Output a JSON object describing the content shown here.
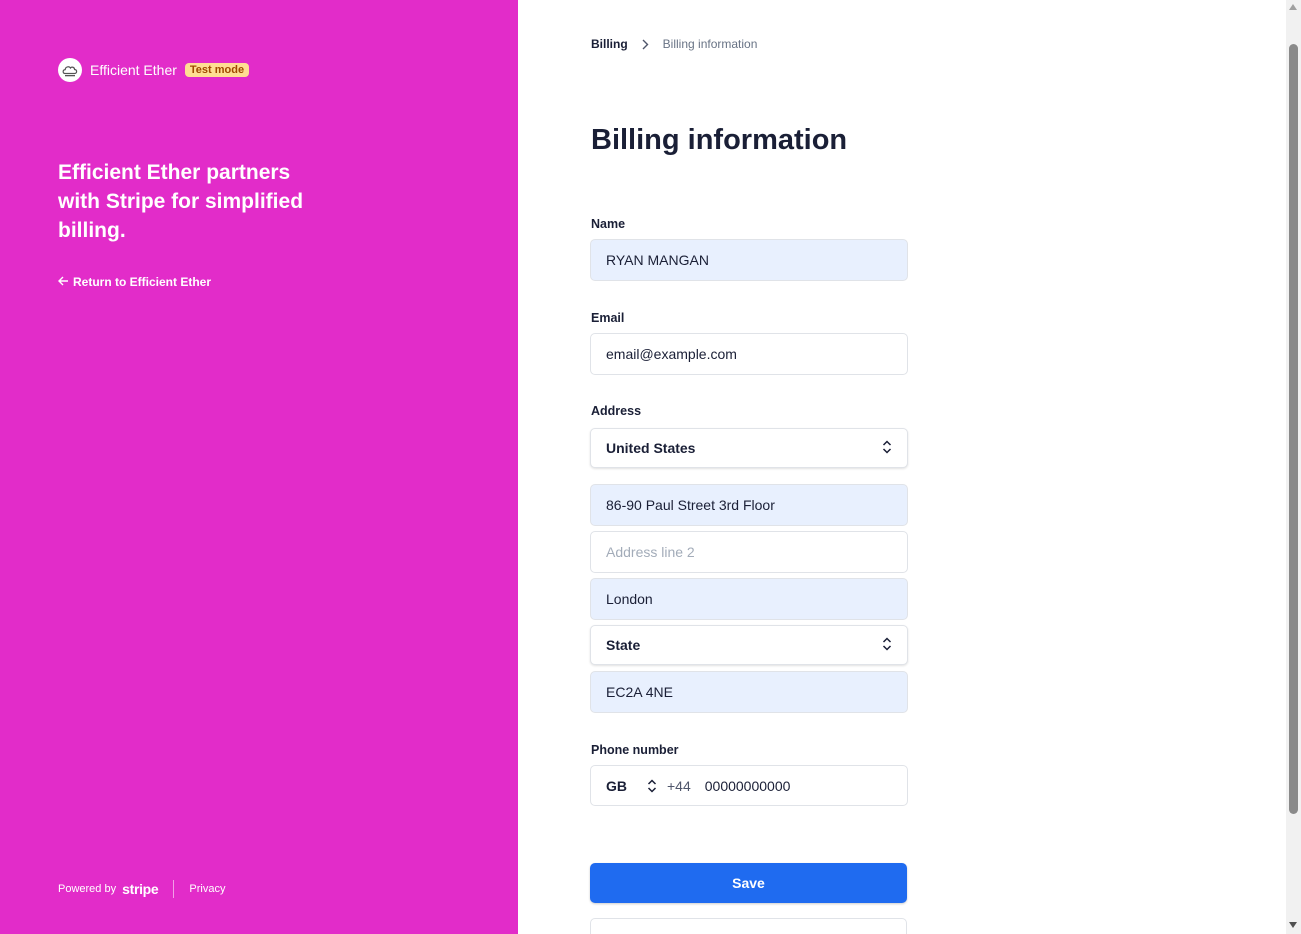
{
  "colors": {
    "brand": "#e22cc9",
    "primary_button": "#1f6bf0",
    "autofill": "#e8f0fe"
  },
  "brand": {
    "name": "Efficient Ether",
    "badge": "Test mode",
    "logo_icon": "cloud-logo-icon"
  },
  "left": {
    "headline": "Efficient Ether partners with Stripe for simplified billing.",
    "return_link": "Return to Efficient Ether",
    "footer": {
      "powered_by": "Powered by",
      "stripe": "stripe",
      "privacy": "Privacy"
    }
  },
  "breadcrumb": {
    "parent": "Billing",
    "current": "Billing information"
  },
  "page_title": "Billing information",
  "form": {
    "name_label": "Name",
    "name_value": "RYAN MANGAN",
    "email_label": "Email",
    "email_value": "email@example.com",
    "address_label": "Address",
    "country_value": "United States",
    "line1_value": "86-90 Paul Street 3rd Floor",
    "line2_placeholder": "Address line 2",
    "city_value": "London",
    "state_value": "State",
    "postal_value": "EC2A 4NE",
    "phone_label": "Phone number",
    "phone_country": "GB",
    "phone_code": "+44",
    "phone_number": "00000000000",
    "save_label": "Save"
  }
}
